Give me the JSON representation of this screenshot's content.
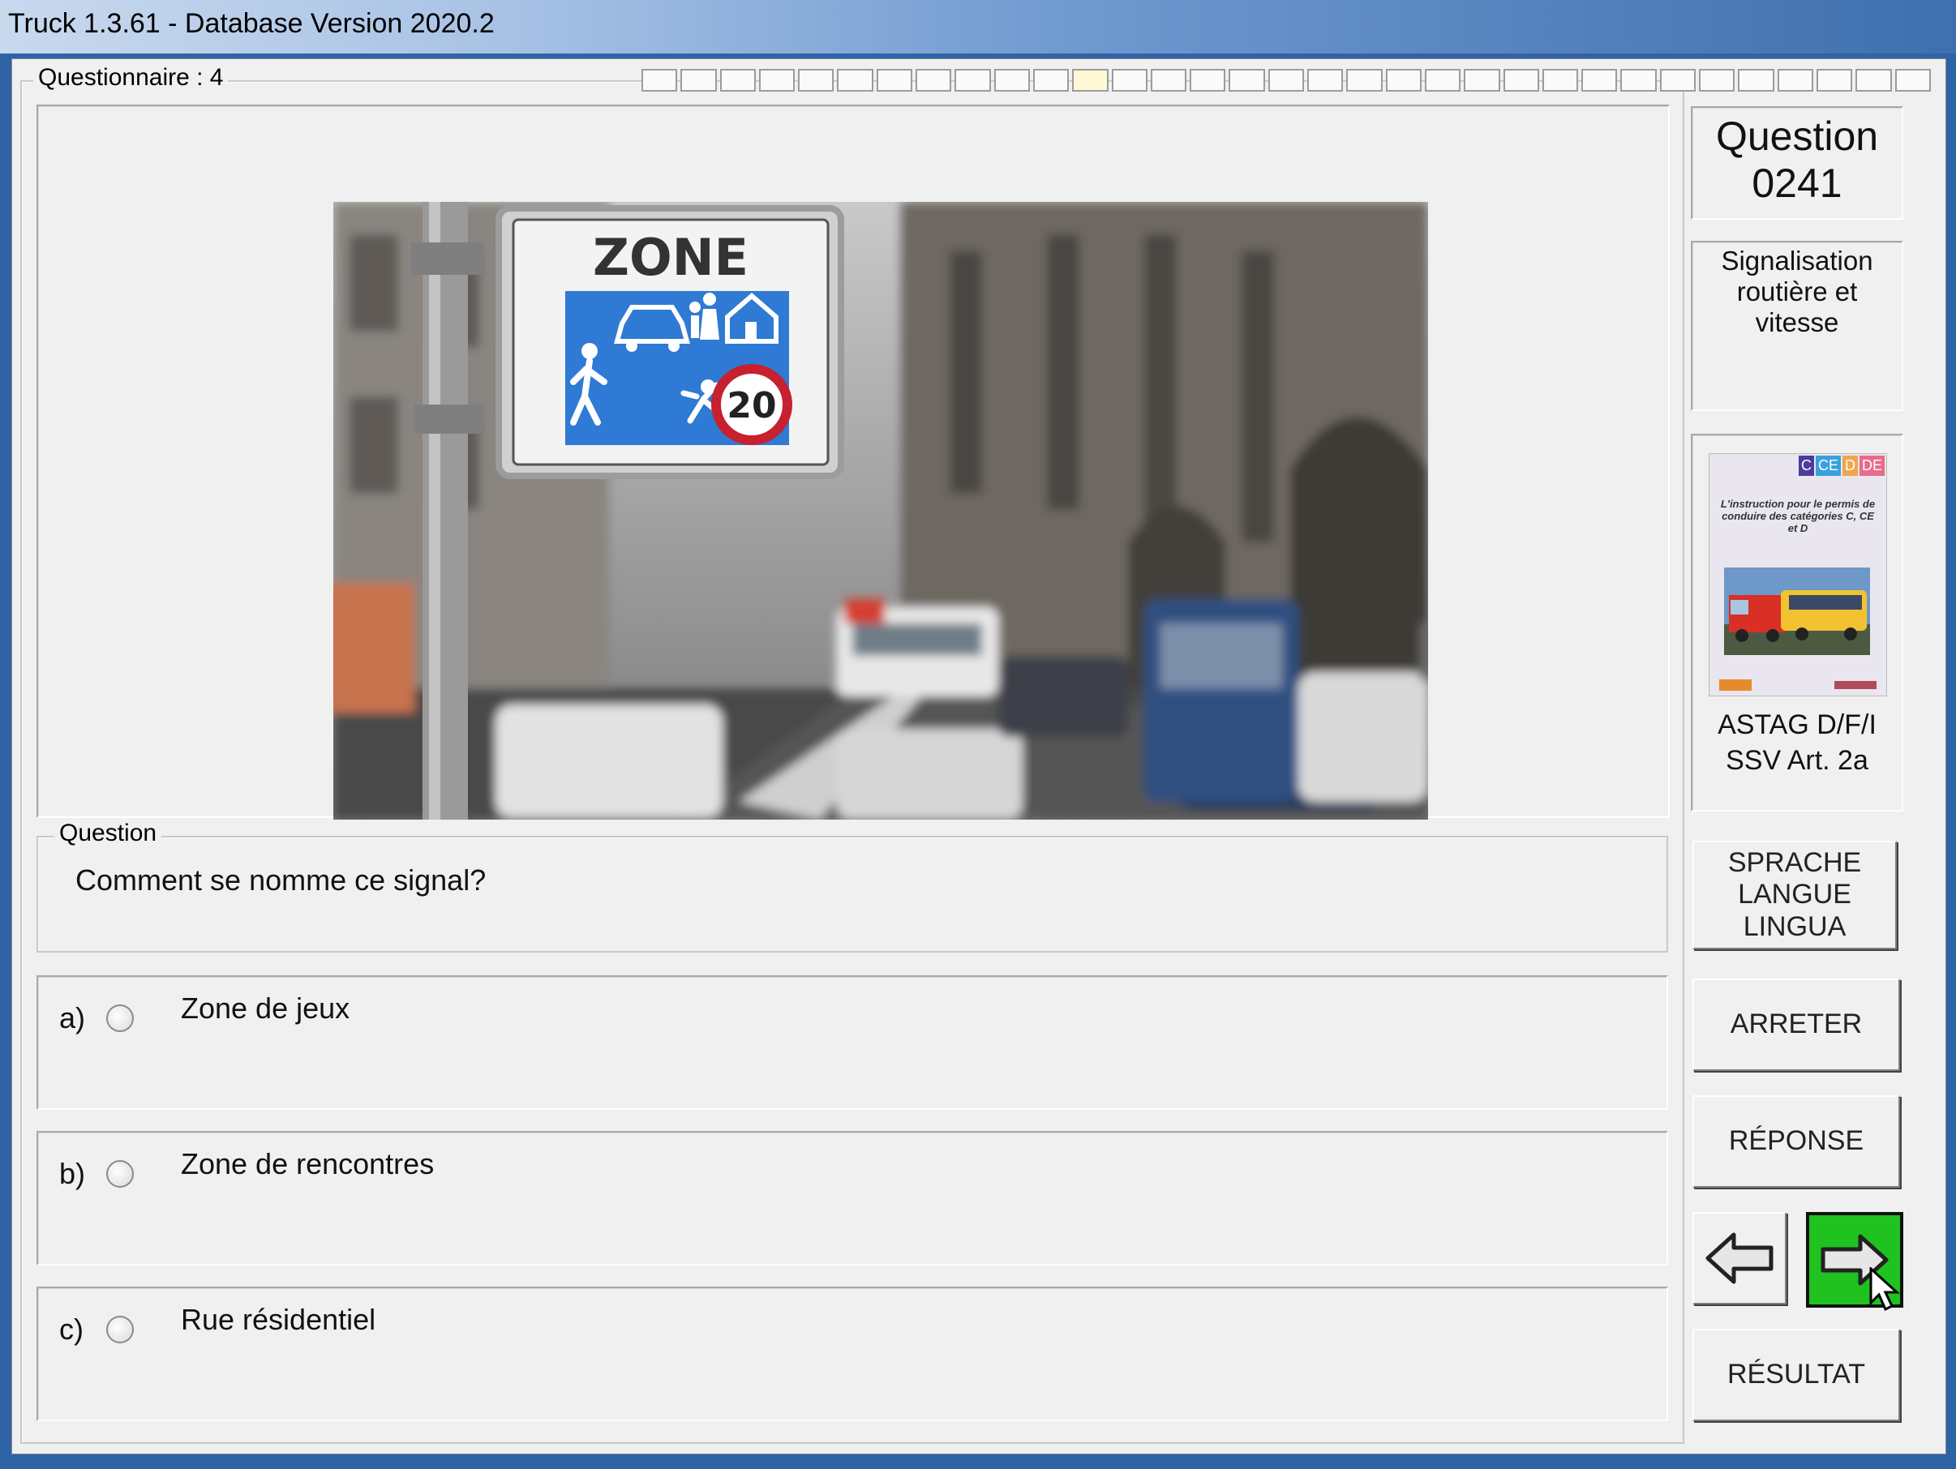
{
  "window": {
    "title": "Truck 1.3.61 - Database Version 2020.2"
  },
  "questionnaire": {
    "label": "Questionnaire : 4",
    "progress_total": 33,
    "progress_current": 12
  },
  "sign": {
    "zone_text": "ZONE",
    "speed": "20"
  },
  "question": {
    "legend": "Question",
    "text": "Comment se nomme ce signal?"
  },
  "answers": [
    {
      "letter": "a)",
      "text": "Zone de jeux"
    },
    {
      "letter": "b)",
      "text": "Zone de rencontres"
    },
    {
      "letter": "c)",
      "text": "Rue résidentiel"
    }
  ],
  "sidebar": {
    "question_label": "Question",
    "question_number": "0241",
    "category": "Signalisation routière et vitesse",
    "book_tags": [
      "C",
      "CE",
      "D",
      "DE"
    ],
    "book_text": "L'instruction pour le permis de conduire des catégories C, CE et D",
    "source_line1": "ASTAG D/F/I",
    "source_line2": "SSV Art. 2a",
    "language_button": "SPRACHE LANGUE LINGUA",
    "stop_button": "ARRETER",
    "answer_button": "RÉPONSE",
    "result_button": "RÉSULTAT"
  }
}
